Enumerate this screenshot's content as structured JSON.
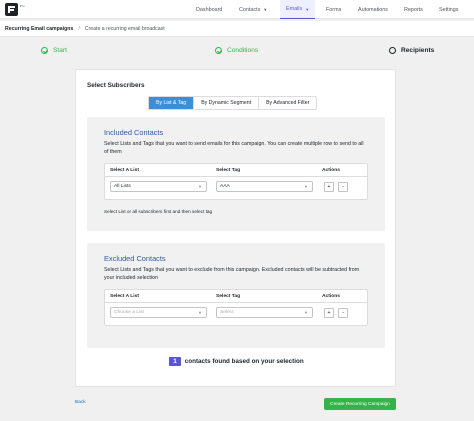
{
  "header": {
    "logo_tag": "Pro",
    "nav": {
      "dashboard": "Dashboard",
      "contacts": "Contacts",
      "emails": "Emails",
      "forms": "Forms",
      "automations": "Automations",
      "reports": "Reports",
      "settings": "Settings"
    }
  },
  "breadcrumb": {
    "main": "Recurring Email campaigns",
    "sep": "/",
    "sub": "Create a recurring email broadcast"
  },
  "steps": [
    {
      "label": "Start",
      "state": "done"
    },
    {
      "label": "Conditions",
      "state": "done"
    },
    {
      "label": "Recipients",
      "state": "current"
    }
  ],
  "select_subscribers": {
    "title": "Select Subscribers",
    "tabs": [
      "By List & Tag",
      "By Dynamic Segment",
      "By Advanced Filter"
    ],
    "active_tab": "By List & Tag"
  },
  "included": {
    "title": "Included Contacts",
    "desc": "Select Lists and Tags that you want to send emails for this campaign. You can create multiple row to send to all of them",
    "headers": {
      "list": "Select A List",
      "tag": "Select Tag",
      "actions": "Actions"
    },
    "list_value": "All Lists",
    "tag_value": "AAA",
    "add": "+",
    "remove": "-",
    "note": "Select List or all subscribers first and then select tag"
  },
  "excluded": {
    "title": "Excluded Contacts",
    "desc": "Select Lists and Tags that you want to exclude from this campaign. Excluded contacts will be subtracted from your included selection",
    "headers": {
      "list": "Select A List",
      "tag": "Select Tag",
      "actions": "Actions"
    },
    "list_placeholder": "Choose a List",
    "tag_placeholder": "Select",
    "add": "+",
    "remove": "-"
  },
  "summary": {
    "count": "1",
    "text": "contacts found based on your selection"
  },
  "footer": {
    "back": "Back",
    "create": "Create Recurring Campaign"
  },
  "colors": {
    "accent": "#5a55d6",
    "tab_active": "#3c8ed9",
    "success": "#35b34a",
    "section_title": "#2d5b9c"
  }
}
